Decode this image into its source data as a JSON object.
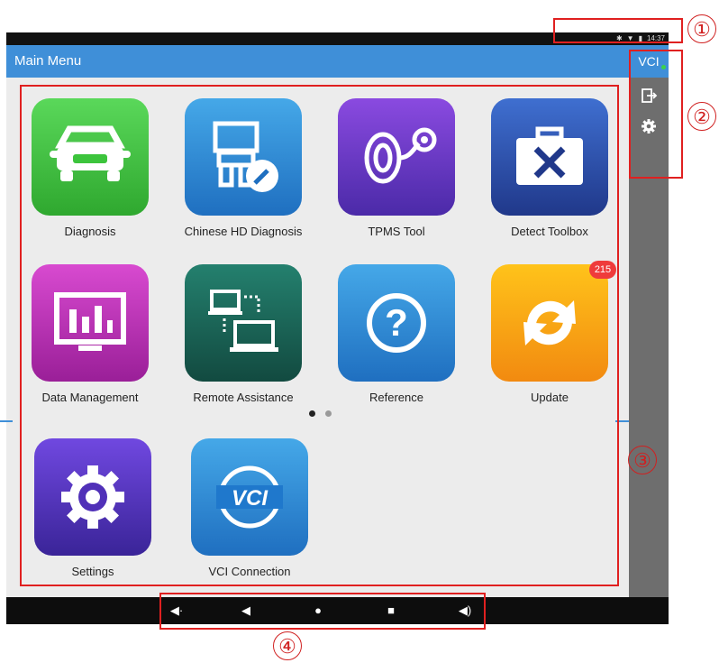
{
  "status_bar": {
    "time": "14:37",
    "icons": [
      "bluetooth-icon",
      "wifi-icon",
      "battery-icon"
    ]
  },
  "header": {
    "title": "Main Menu"
  },
  "sidebar": {
    "vci_label": "VCI",
    "items": [
      {
        "icon": "exit-icon"
      },
      {
        "icon": "gear-icon"
      }
    ]
  },
  "apps": [
    {
      "label": "Diagnosis",
      "icon": "car-wrench-icon",
      "color": "#3cc43c"
    },
    {
      "label": "Chinese HD Diagnosis",
      "icon": "truck-wrench-icon",
      "color": "#2f8fd8"
    },
    {
      "label": "TPMS Tool",
      "icon": "tire-pressure-icon",
      "color": "#7b3fd8"
    },
    {
      "label": "Detect Toolbox",
      "icon": "toolbox-icon",
      "color": "#2f5bb8"
    },
    {
      "label": "Data Management",
      "icon": "chart-monitor-icon",
      "color": "#c23bb8"
    },
    {
      "label": "Remote Assistance",
      "icon": "computers-icon",
      "color": "#1a6e5e"
    },
    {
      "label": "Reference",
      "icon": "question-icon",
      "color": "#2f8fd8"
    },
    {
      "label": "Update",
      "icon": "refresh-icon",
      "color": "#f5a21a",
      "badge": "215"
    },
    {
      "label": "Settings",
      "icon": "gear-icon",
      "color": "#5b3fc8"
    },
    {
      "label": "VCI Connection",
      "icon": "vci-icon",
      "color": "#2f8fd8"
    }
  ],
  "pager": {
    "pages": 2,
    "current": 1
  },
  "nav_bar": {
    "buttons": [
      "volume-down-icon",
      "back-icon",
      "home-icon",
      "recents-icon",
      "volume-up-icon"
    ]
  },
  "callouts": [
    "①",
    "②",
    "③",
    "④"
  ]
}
